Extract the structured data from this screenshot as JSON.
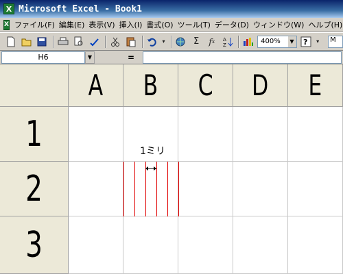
{
  "window": {
    "title": "Microsoft Excel - Book1",
    "app_icon_glyph": "X"
  },
  "menubar": {
    "items": [
      "ファイル(F)",
      "編集(E)",
      "表示(V)",
      "挿入(I)",
      "書式(O)",
      "ツール(T)",
      "データ(D)",
      "ウィンドウ(W)",
      "ヘルプ(H)"
    ]
  },
  "toolbar": {
    "icons": [
      "new-file-icon",
      "open-folder-icon",
      "save-icon",
      "print-icon",
      "print-preview-icon",
      "spelling-icon",
      "cut-icon",
      "paste-icon",
      "undo-icon",
      "insert-hyperlink-icon",
      "autosum-icon",
      "function-icon",
      "sort-ascending-icon",
      "chart-wizard-icon",
      "help-icon"
    ],
    "zoom": "400%",
    "extra_box": "M"
  },
  "formulabar": {
    "name_box": "H6",
    "equals": "=",
    "content": ""
  },
  "sheet": {
    "columns": [
      "A",
      "B",
      "C",
      "D",
      "E"
    ],
    "rows": [
      "1",
      "2",
      "3"
    ]
  },
  "annotation": {
    "label": "1ミリ",
    "line_color": "#E00000"
  }
}
